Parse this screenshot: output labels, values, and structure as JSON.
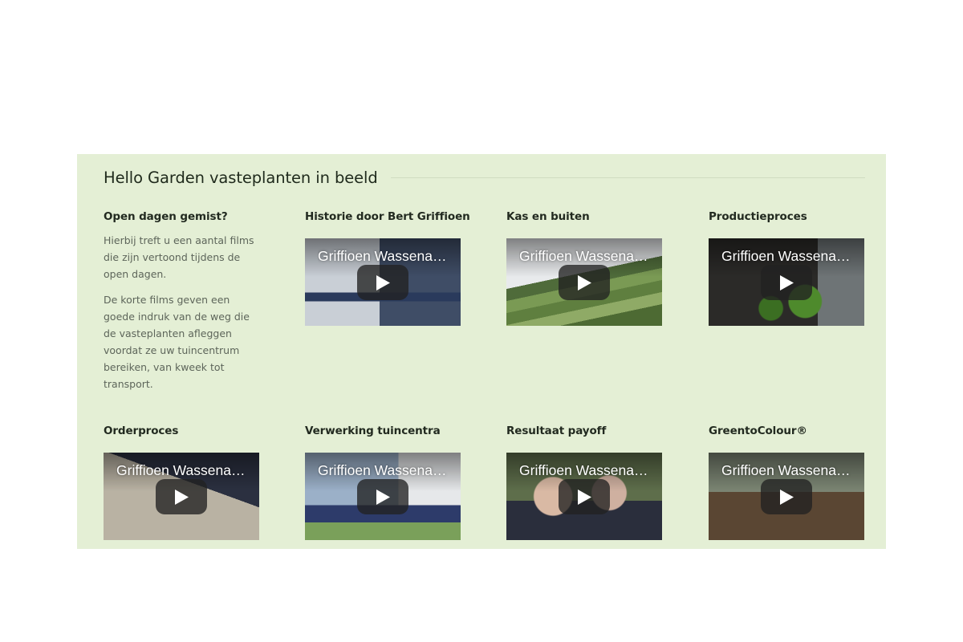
{
  "section": {
    "title": "Hello Garden vasteplanten in beeld"
  },
  "intro": {
    "title": "Open dagen gemist?",
    "paragraphs": [
      "Hierbij treft u een aantal films die zijn vertoond tijdens de open dagen.",
      "De korte films geven een goede indruk van de weg die de vasteplanten afleggen voordat ze uw tuincentrum bereiken, van kweek tot transport."
    ]
  },
  "videos": [
    {
      "title": "Historie door Bert Griffioen",
      "video_title": "Griffioen Wassenaar..."
    },
    {
      "title": "Kas en buiten",
      "video_title": "Griffioen Wassenaar..."
    },
    {
      "title": "Productieproces",
      "video_title": "Griffioen Wassenaar..."
    },
    {
      "title": "Orderproces",
      "video_title": "Griffioen Wassenaar..."
    },
    {
      "title": "Verwerking tuincentra",
      "video_title": "Griffioen Wassenaar..."
    },
    {
      "title": "Resultaat payoff",
      "video_title": "Griffioen Wassenaar..."
    },
    {
      "title": "GreentoColour®",
      "video_title": "Griffioen Wassenaar..."
    }
  ],
  "icons": {
    "play": "play-icon"
  },
  "colors": {
    "section_background": "#e4efd5",
    "play_button": "#212121"
  }
}
